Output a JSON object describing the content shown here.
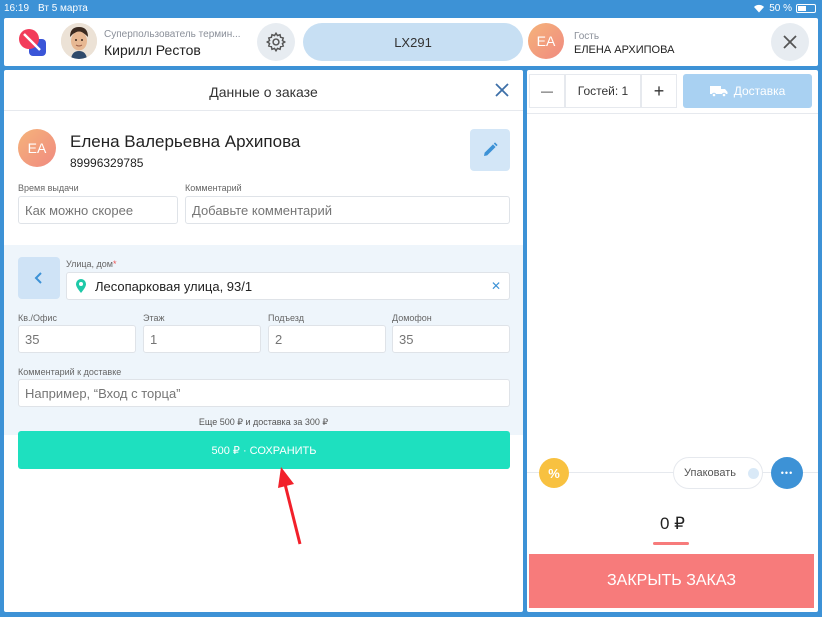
{
  "status_bar": {
    "time": "16:19",
    "date": "Вт 5 марта",
    "battery": "50 %"
  },
  "header": {
    "user_role": "Суперпользователь термин...",
    "user_name": "Кирилл Рестов",
    "table_code": "LX291",
    "guest_initials": "EA",
    "guest_label": "Гость",
    "guest_name": "ЕЛЕНА АРХИПОВА"
  },
  "order_panel": {
    "title": "Данные о заказе",
    "customer": {
      "initials": "EA",
      "name": "Елена Валерьевна Архипова",
      "phone": "89996329785"
    },
    "pickup_time": {
      "label": "Время выдачи",
      "placeholder": "Как можно скорее"
    },
    "comment": {
      "label": "Комментарий",
      "placeholder": "Добавьте комментарий"
    },
    "address": {
      "street_label": "Улица, дом",
      "required_mark": "*",
      "street_value": "Лесопарковая улица, 93/1",
      "apartment": {
        "label": "Кв./Офис",
        "placeholder": "35"
      },
      "floor": {
        "label": "Этаж",
        "placeholder": "1"
      },
      "entrance": {
        "label": "Подъезд",
        "placeholder": "2"
      },
      "intercom": {
        "label": "Домофон",
        "placeholder": "35"
      },
      "delivery_comment": {
        "label": "Комментарий к доставке",
        "placeholder": "Например, “Вход с торца”"
      }
    },
    "hint": "Еще 500 ₽ и доставка за 300 ₽",
    "save_button": "500 ₽ · СОХРАНИТЬ"
  },
  "cart_panel": {
    "guests_label": "Гостей: 1",
    "minus": "—",
    "plus": "+",
    "delivery_button": "Доставка",
    "discount_symbol": "%",
    "pack_label": "Упаковать",
    "more_symbol": "•••",
    "total": "0 ₽",
    "close_order_button": "ЗАКРЫТЬ ЗАКАЗ"
  },
  "colors": {
    "accent": "#3d92d6",
    "save": "#1ee0bf",
    "close_order": "#f77b7b",
    "discount": "#f8c140"
  }
}
